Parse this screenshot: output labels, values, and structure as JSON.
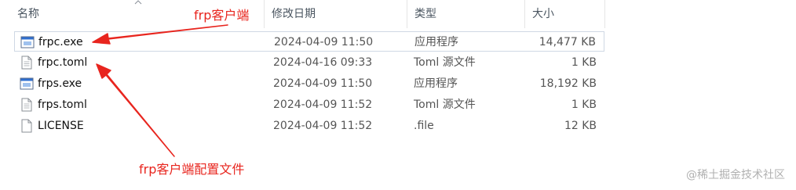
{
  "columns": {
    "name": "名称",
    "date": "修改日期",
    "type": "类型",
    "size": "大小"
  },
  "files": [
    {
      "name": "frpc.exe",
      "date": "2024-04-09 11:50",
      "type": "应用程序",
      "size": "14,477 KB",
      "icon": "exe-icon",
      "selected": true
    },
    {
      "name": "frpc.toml",
      "date": "2024-04-16 09:33",
      "type": "Toml 源文件",
      "size": "1 KB",
      "icon": "document-icon",
      "selected": false
    },
    {
      "name": "frps.exe",
      "date": "2024-04-09 11:50",
      "type": "应用程序",
      "size": "18,192 KB",
      "icon": "exe-icon",
      "selected": false
    },
    {
      "name": "frps.toml",
      "date": "2024-04-09 11:52",
      "type": "Toml 源文件",
      "size": "1 KB",
      "icon": "document-icon",
      "selected": false
    },
    {
      "name": "LICENSE",
      "date": "2024-04-09 11:52",
      "type": ".file",
      "size": "12 KB",
      "icon": "document-icon",
      "selected": false
    }
  ],
  "annotations": {
    "client": "frp客户端",
    "client_config": "frp客户端配置文件"
  },
  "watermark": "@稀土掘金技术社区",
  "colors": {
    "annotation": "#e8251e",
    "header_text": "#4a5560",
    "selection_border": "#cfd8e4"
  }
}
